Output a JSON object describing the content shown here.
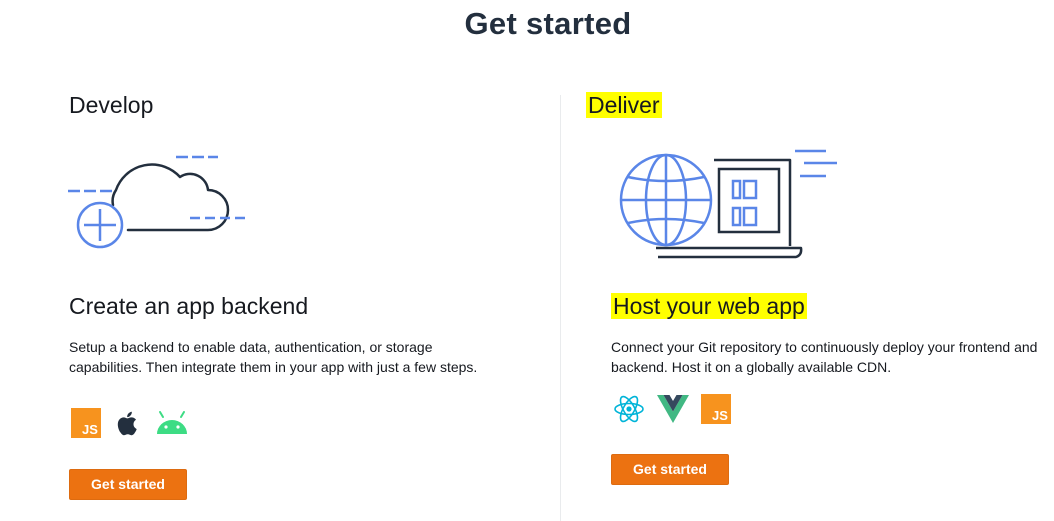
{
  "page": {
    "title": "Get started"
  },
  "develop": {
    "heading": "Develop",
    "card_title": "Create an app backend",
    "description": "Setup a backend to enable data, authentication, or storage capabilities. Then integrate them in your app with just a few steps.",
    "icons": [
      "javascript-icon",
      "apple-icon",
      "android-icon"
    ],
    "button_label": "Get started"
  },
  "deliver": {
    "heading": "Deliver",
    "card_title": "Host your web app",
    "description": "Connect your Git repository to continuously deploy your frontend and backend. Host it on a globally available CDN.",
    "icons": [
      "react-icon",
      "vue-icon",
      "javascript-icon"
    ],
    "button_label": "Get started"
  },
  "colors": {
    "accent": "#ec7211",
    "illustration_blue": "#5a86e8",
    "highlight": "#ffff00",
    "text": "#16191f"
  }
}
